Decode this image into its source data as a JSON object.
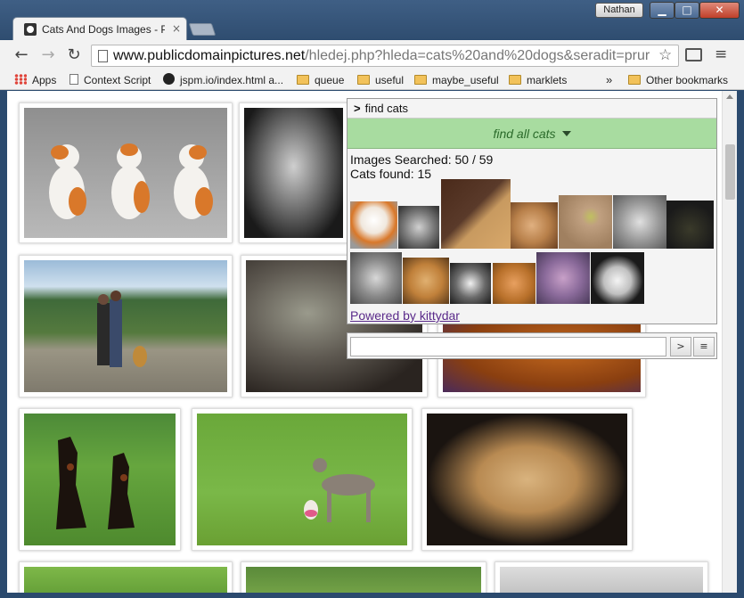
{
  "window": {
    "user": "Nathan",
    "min_glyph": "▁",
    "max_glyph": "□",
    "close_glyph": "✕"
  },
  "tab": {
    "title": "Cats And Dogs Images - P",
    "close_glyph": "×"
  },
  "toolbar": {
    "back_glyph": "←",
    "forward_glyph": "→",
    "reload_glyph": "↻",
    "url_host": "www.publicdomainpictures.net",
    "url_path": "/hledej.php?hleda=cats%20and%20dogs&seradit=prur",
    "star_glyph": "☆",
    "menu_glyph": "≡"
  },
  "bookmarks": {
    "items": [
      {
        "label": "Apps",
        "icon": "apps-icon"
      },
      {
        "label": "Context Script",
        "icon": "document-icon"
      },
      {
        "label": "jspm.io/index.html a...",
        "icon": "github-icon"
      },
      {
        "label": "queue",
        "icon": "folder-icon"
      },
      {
        "label": "useful",
        "icon": "folder-icon"
      },
      {
        "label": "maybe_useful",
        "icon": "folder-icon"
      },
      {
        "label": "marklets",
        "icon": "folder-icon"
      }
    ],
    "overflow": "»",
    "other": "Other bookmarks"
  },
  "panel": {
    "prompt": ">",
    "command": "find cats",
    "find_all": "find all cats",
    "images_searched_label": "Images Searched: 50 / 59",
    "cats_found_label": "Cats found: 15",
    "cats_found": 15,
    "images_searched": 50,
    "images_total": 59,
    "powered_by": "Powered by kittydar"
  },
  "searchbar": {
    "value": "",
    "go_label": ">",
    "menu_label": "≡"
  },
  "colors": {
    "accent_green": "#a8dca0",
    "link_purple": "#5a2a8a",
    "frame_blue": "#2b4a6e"
  }
}
